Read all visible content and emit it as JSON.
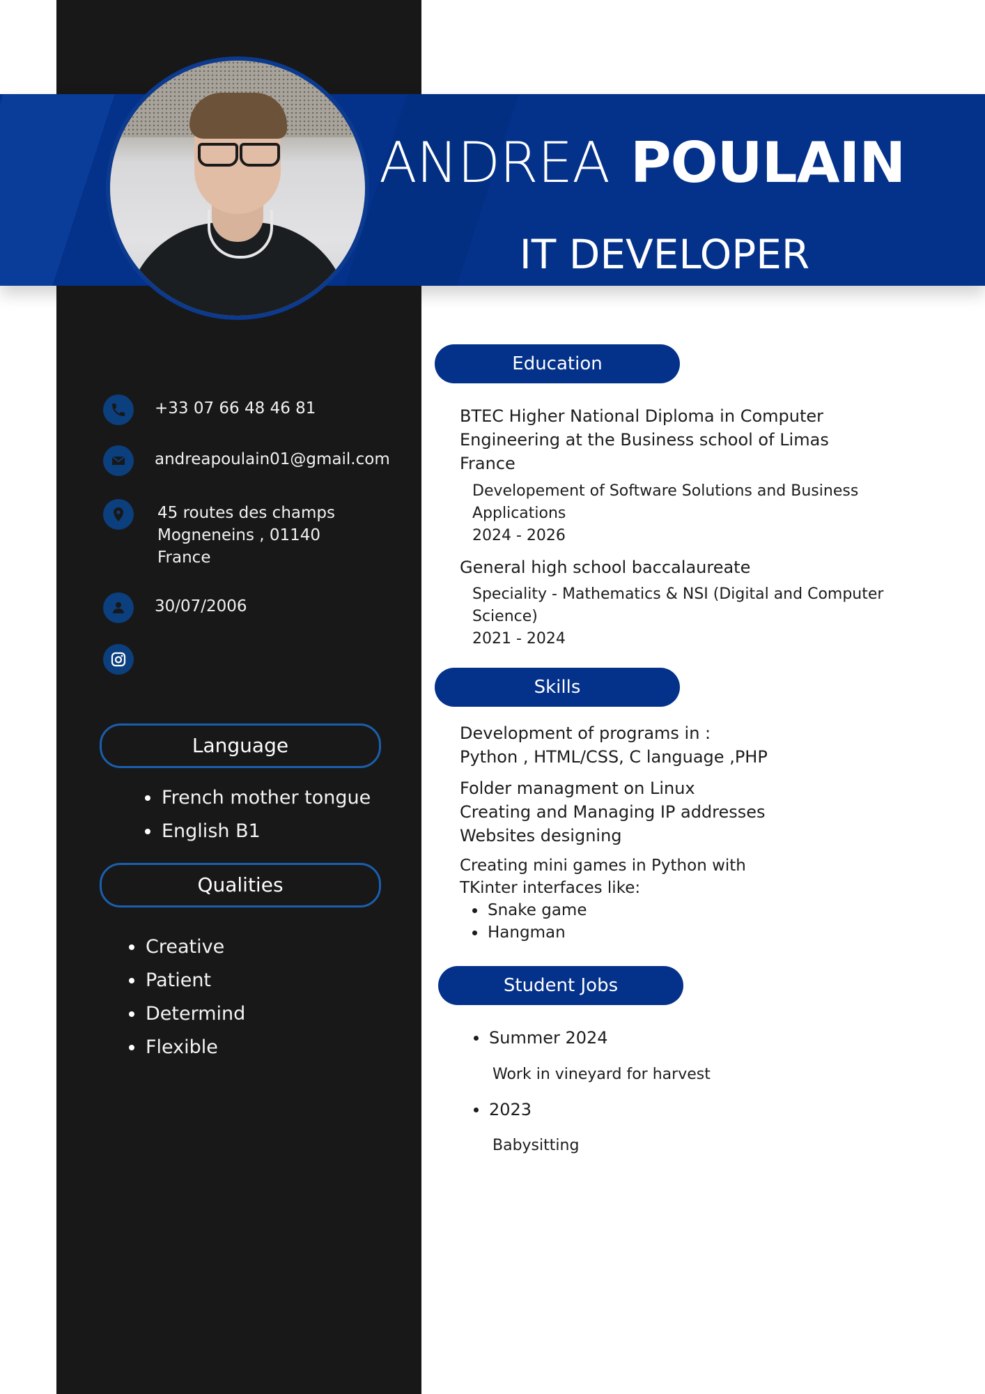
{
  "header": {
    "first_name": "ANDREA",
    "last_name": "POULAIN",
    "job_title": "IT DEVELOPER",
    "accent_color": "#04318a"
  },
  "contact": {
    "phone": "+33 07 66 48 46 81",
    "email": "andreapoulain01@gmail.com",
    "address_lines": [
      "45 routes des champs",
      "Mogneneins , 01140",
      "France"
    ],
    "birthdate": "30/07/2006",
    "icons": [
      "phone-icon",
      "mail-icon",
      "location-pin-icon",
      "person-icon",
      "instagram-icon"
    ]
  },
  "language": {
    "heading": "Language",
    "items": [
      "French mother tongue",
      "English B1"
    ]
  },
  "qualities": {
    "heading": "Qualities",
    "items": [
      "Creative",
      "Patient",
      "Determind",
      "Flexible"
    ]
  },
  "education": {
    "heading": "Education",
    "entries": [
      {
        "title_lines": [
          "BTEC Higher National Diploma in Computer",
          "Engineering at the Business school of Limas",
          "France"
        ],
        "detail_lines": [
          "Developement of Software Solutions and Business",
          "Applications",
          "2024 - 2026"
        ]
      },
      {
        "title_lines": [
          "General high school baccalaureate"
        ],
        "detail_lines": [
          "Speciality - Mathematics & NSI (Digital and Computer",
          "Science)",
          "2021 - 2024"
        ]
      }
    ]
  },
  "skills": {
    "heading": "Skills",
    "block1": [
      "Development of programs in :",
      "Python , HTML/CSS, C language ,PHP"
    ],
    "block2": [
      "Folder managment on Linux",
      "Creating and Managing IP addresses",
      "Websites designing"
    ],
    "block3": [
      "Creating mini games in Python with",
      "TKinter interfaces like:"
    ],
    "games": [
      "Snake game",
      "Hangman"
    ]
  },
  "jobs": {
    "heading": "Student Jobs",
    "items": [
      {
        "period": "Summer 2024",
        "description": "Work in vineyard for harvest"
      },
      {
        "period": "2023",
        "description": "Babysitting"
      }
    ]
  }
}
